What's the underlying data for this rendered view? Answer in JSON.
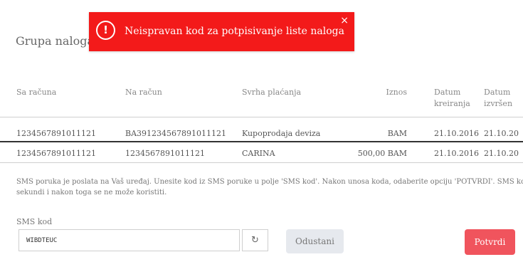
{
  "section": {
    "title": "Grupa naloga z"
  },
  "toast": {
    "icon": "exclamation-circle-icon",
    "icon_glyph": "!",
    "message": "Neispravan kod za potpisivanje liste naloga",
    "close_glyph": "×",
    "background": "#f31a1a"
  },
  "table": {
    "headers": {
      "from_account": "Sa računa",
      "to_account": "Na račun",
      "purpose": "Svrha plaćanja",
      "amount": "Iznos",
      "created_line1": "Datum",
      "created_line2": "kreiranja",
      "executed_line1": "Datum",
      "executed_line2": "izvršen"
    },
    "rows": [
      {
        "from_account": "1234567891011121",
        "to_account": "BA391234567891011121",
        "purpose": "Kupoprodaja deviza",
        "amount": "BAM",
        "created": "21.10.2016",
        "executed": "21.10.20"
      },
      {
        "from_account": "1234567891011121",
        "to_account": "1234567891011121",
        "purpose": "CARINA",
        "amount": "500,00 BAM",
        "created": "21.10.2016",
        "executed": "21.10.20"
      }
    ]
  },
  "info": {
    "line1": "SMS poruka je poslata na Vaš uređaj. Unesite kod iz SMS poruke u polje 'SMS kod'. Nakon unosa koda, odaberite opciju 'POTVRDI'. SMS kod važi 1",
    "line2": "sekundi i nakon toga se ne može koristiti."
  },
  "sms": {
    "label": "SMS kod",
    "value": "WIBDTEUC",
    "refresh_icon": "refresh-icon",
    "refresh_glyph": "↻"
  },
  "actions": {
    "cancel_label": "Odustani",
    "confirm_label": "Potvrdi",
    "confirm_color": "#f0545d"
  }
}
